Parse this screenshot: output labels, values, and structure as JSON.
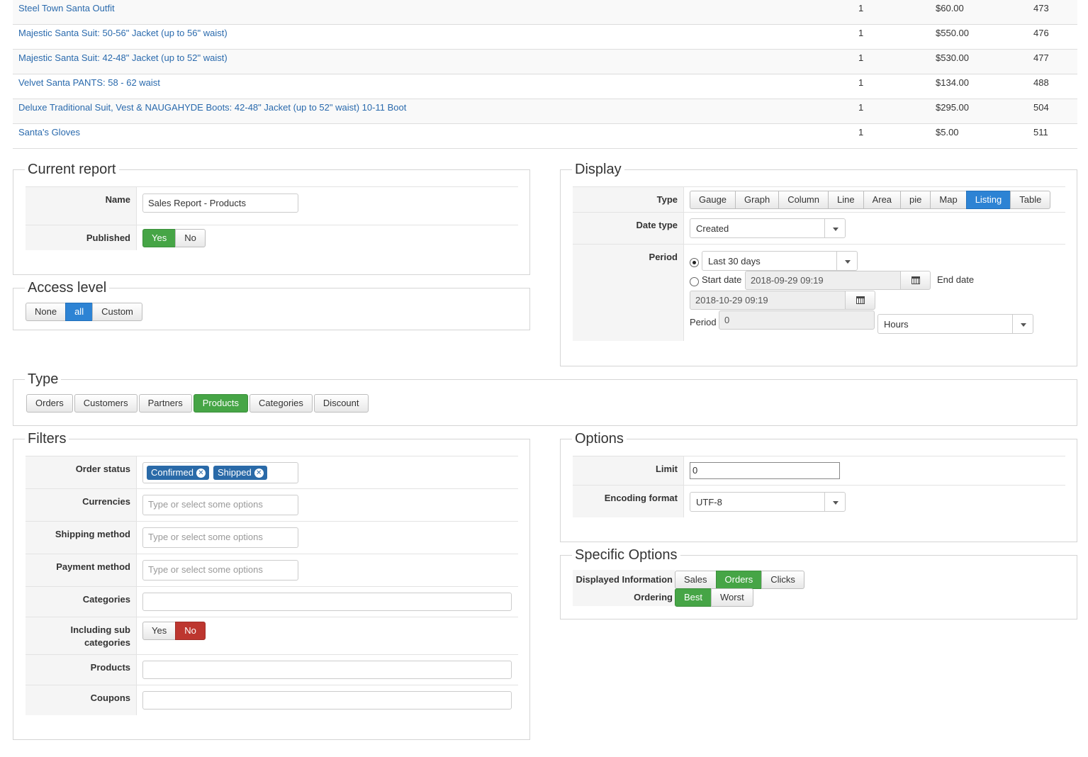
{
  "products_table": {
    "rows": [
      {
        "name": "Steel Town Santa Outfit",
        "qty": "1",
        "price": "$60.00",
        "id": "473"
      },
      {
        "name": "Majestic Santa Suit: 50-56\" Jacket (up to 56\" waist)",
        "qty": "1",
        "price": "$550.00",
        "id": "476"
      },
      {
        "name": "Majestic Santa Suit: 42-48\" Jacket (up to 52\" waist)",
        "qty": "1",
        "price": "$530.00",
        "id": "477"
      },
      {
        "name": "Velvet Santa PANTS: 58 - 62 waist",
        "qty": "1",
        "price": "$134.00",
        "id": "488"
      },
      {
        "name": "Deluxe Traditional Suit, Vest & NAUGAHYDE Boots: 42-48\" Jacket (up to 52\" waist) 10-11 Boot",
        "qty": "1",
        "price": "$295.00",
        "id": "504"
      },
      {
        "name": "Santa's Gloves",
        "qty": "1",
        "price": "$5.00",
        "id": "511"
      }
    ]
  },
  "current_report": {
    "legend": "Current report",
    "name_label": "Name",
    "name_value": "Sales Report - Products",
    "published_label": "Published",
    "published_yes": "Yes",
    "published_no": "No"
  },
  "access_level": {
    "legend": "Access level",
    "options": [
      "None",
      "all",
      "Custom"
    ],
    "selected": "all"
  },
  "display": {
    "legend": "Display",
    "type_label": "Type",
    "types": [
      "Gauge",
      "Graph",
      "Column",
      "Line",
      "Area",
      "pie",
      "Map",
      "Listing",
      "Table"
    ],
    "selected_type": "Listing",
    "date_type_label": "Date type",
    "date_type_value": "Created",
    "period_label": "Period",
    "period_preset": "Last 30 days",
    "start_date_label": "Start date",
    "start_date": "2018-09-29 09:19",
    "end_date_label": "End date",
    "end_date": "2018-10-29 09:19",
    "period_inline_label": "Period",
    "period_value": "0",
    "period_unit": "Hours"
  },
  "type_section": {
    "legend": "Type",
    "options": [
      "Orders",
      "Customers",
      "Partners",
      "Products",
      "Categories",
      "Discount"
    ],
    "selected": "Products"
  },
  "filters": {
    "legend": "Filters",
    "order_status_label": "Order status",
    "order_status_tags": [
      "Confirmed",
      "Shipped"
    ],
    "currencies_label": "Currencies",
    "shipping_label": "Shipping method",
    "payment_label": "Payment method",
    "placeholder": "Type or select some options",
    "categories_label": "Categories",
    "sub_categories_label_1": "Including sub",
    "sub_categories_label_2": "categories",
    "sub_yes": "Yes",
    "sub_no": "No",
    "products_label": "Products",
    "coupons_label": "Coupons"
  },
  "options": {
    "legend": "Options",
    "limit_label": "Limit",
    "limit_value": "0",
    "encoding_label": "Encoding format",
    "encoding_value": "UTF-8"
  },
  "specific_options": {
    "legend": "Specific Options",
    "displayed_label": "Displayed Information",
    "displayed_options": [
      "Sales",
      "Orders",
      "Clicks"
    ],
    "displayed_selected": "Orders",
    "ordering_label": "Ordering",
    "ordering_options": [
      "Best",
      "Worst"
    ],
    "ordering_selected": "Best"
  },
  "colors": {
    "link": "#2a6aad",
    "selected_green": "#46a546",
    "selected_blue": "#2d83d4",
    "selected_red": "#bd362f",
    "tag_blue": "#2a6aa8"
  }
}
